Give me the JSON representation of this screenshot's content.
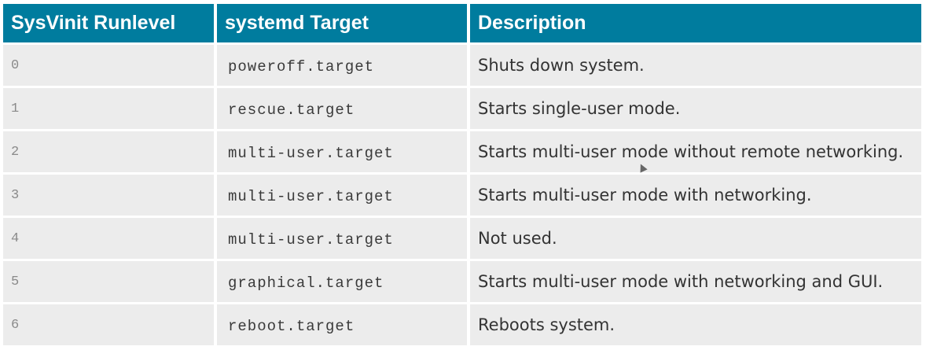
{
  "table": {
    "headers": [
      "SysVinit Runlevel",
      "systemd Target",
      "Description"
    ],
    "rows": [
      {
        "runlevel": "0",
        "target": "poweroff.target",
        "description": "Shuts down system."
      },
      {
        "runlevel": "1",
        "target": "rescue.target",
        "description": "Starts single-user mode."
      },
      {
        "runlevel": "2",
        "target": "multi-user.target",
        "description": "Starts multi-user mode without remote networking."
      },
      {
        "runlevel": "3",
        "target": "multi-user.target",
        "description": "Starts multi-user mode with networking."
      },
      {
        "runlevel": "4",
        "target": "multi-user.target",
        "description": "Not used."
      },
      {
        "runlevel": "5",
        "target": "graphical.target",
        "description": "Starts multi-user mode with networking and GUI."
      },
      {
        "runlevel": "6",
        "target": "reboot.target",
        "description": "Reboots system."
      }
    ]
  },
  "colors": {
    "header_bg": "#007c9e",
    "row_bg": "#ececec"
  }
}
